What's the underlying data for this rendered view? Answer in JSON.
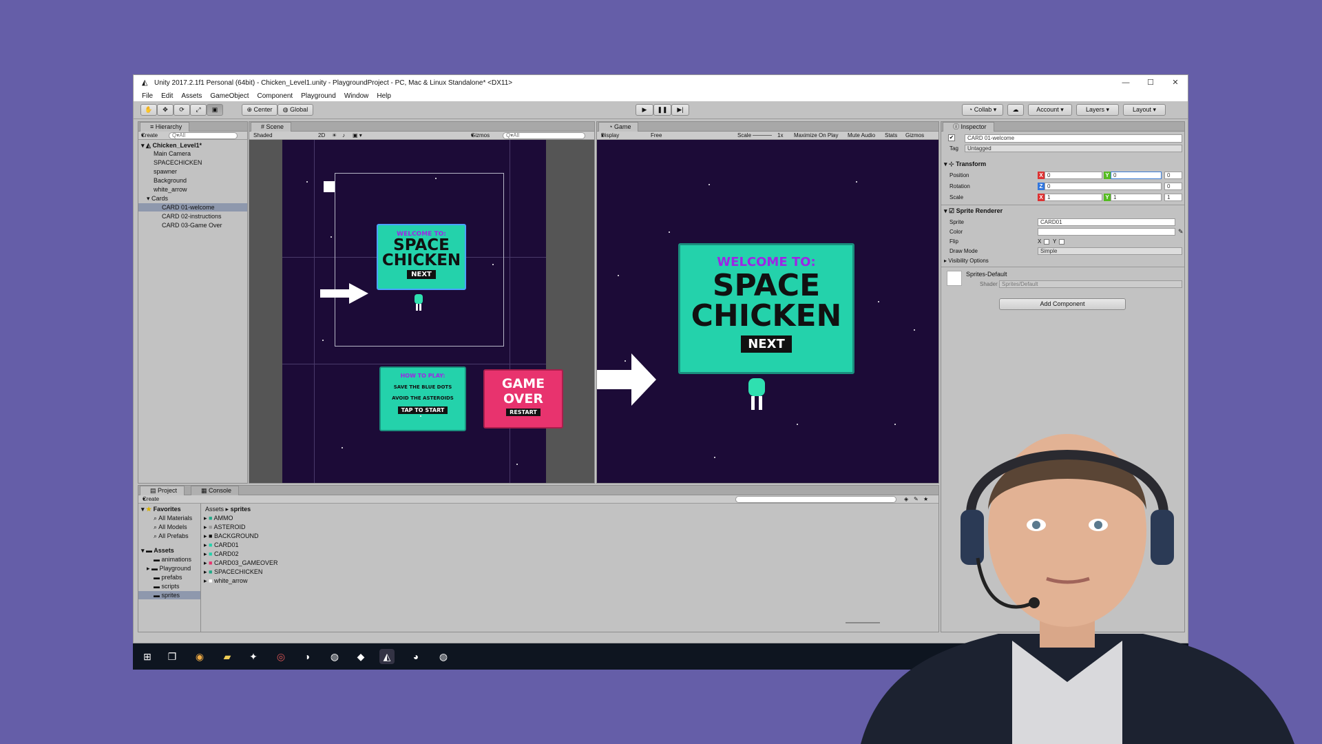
{
  "window": {
    "title": "Unity 2017.2.1f1 Personal (64bit) - Chicken_Level1.unity - PlaygroundProject - PC, Mac & Linux Standalone* <DX11>",
    "controls": [
      "—",
      "☐",
      "✕"
    ]
  },
  "menu": [
    "File",
    "Edit",
    "Assets",
    "GameObject",
    "Component",
    "Playground",
    "Window",
    "Help"
  ],
  "toolbar": {
    "pivot": "Center",
    "space": "Global",
    "collab": "Collab",
    "account": "Account",
    "layers": "Layers",
    "layout": "Layout"
  },
  "hierarchy": {
    "tab": "Hierarchy",
    "create": "Create",
    "search": "Q▾All",
    "scene": "Chicken_Level1*",
    "items": [
      "Main Camera",
      "SPACECHICKEN",
      "spawner",
      "Background",
      "white_arrow",
      "Cards"
    ],
    "children": [
      "CARD 01-welcome",
      "CARD 02-instructions",
      "CARD 03-Game Over"
    ]
  },
  "scene": {
    "tab": "Scene",
    "shading": "Shaded",
    "mode2d": "2D",
    "gizmos": "Gizmos",
    "search": "Q▾All"
  },
  "game": {
    "tab": "Game",
    "display": "Display 1",
    "aspect": "Free Aspect",
    "scale_label": "Scale",
    "scale_value": "1x",
    "maximize": "Maximize On Play",
    "mute": "Mute Audio",
    "stats": "Stats",
    "gizmos": "Gizmos"
  },
  "cards": {
    "welcome_top": "WELCOME TO:",
    "title_line1": "SPACE",
    "title_line2": "CHICKEN",
    "next": "NEXT",
    "howto_title": "HOW TO PLAY:",
    "howto_line1": "SAVE THE BLUE DOTS",
    "howto_line2": "AVOID THE ASTEROIDS",
    "howto_btn": "TAP TO START",
    "gameover_line1": "GAME",
    "gameover_line2": "OVER",
    "restart": "RESTART"
  },
  "inspector": {
    "tab": "Inspector",
    "object_name": "CARD 01-welcome",
    "tag_label": "Tag",
    "tag_value": "Untagged",
    "transform": {
      "title": "Transform",
      "position": "Position",
      "rotation": "Rotation",
      "scale": "Scale",
      "pos_x": "0",
      "pos_y": "0",
      "pos_z": "0",
      "rot_z": "0",
      "rot_z2": "0",
      "scale_x": "1",
      "scale_y": "1",
      "scale_z": "1"
    },
    "sprite_renderer": {
      "title": "Sprite Renderer",
      "sprite_label": "Sprite",
      "sprite_value": "CARD01",
      "color_label": "Color",
      "flip_label": "Flip",
      "flip_x": "X",
      "flip_y": "Y",
      "draw_mode_label": "Draw Mode",
      "draw_mode_value": "Simple",
      "visibility": "Visibility Options"
    },
    "material": {
      "name": "Sprites-Default",
      "shader_label": "Shader",
      "shader_value": "Sprites/Default"
    },
    "add_component": "Add Component"
  },
  "project": {
    "tab": "Project",
    "console_tab": "Console",
    "create": "Create",
    "favorites_label": "Favorites",
    "favorites": [
      "All Materials",
      "All Models",
      "All Prefabs"
    ],
    "assets_label": "Assets",
    "folders": [
      "animations",
      "Playground",
      "prefabs",
      "scripts",
      "sprites"
    ],
    "breadcrumb_root": "Assets",
    "breadcrumb_sep": "▸",
    "breadcrumb_current": "sprites",
    "files": [
      "AMMO",
      "ASTEROID",
      "BACKGROUND",
      "CARD01",
      "CARD02",
      "CARD03_GAMEOVER",
      "SPACECHICKEN",
      "white_arrow"
    ]
  },
  "colors": {
    "desktop": "#655ea8",
    "space_bg": "#1c0b37",
    "card_teal": "#24d2ab",
    "card_pink": "#e8336e",
    "welcome_purple": "#9d26e6"
  }
}
